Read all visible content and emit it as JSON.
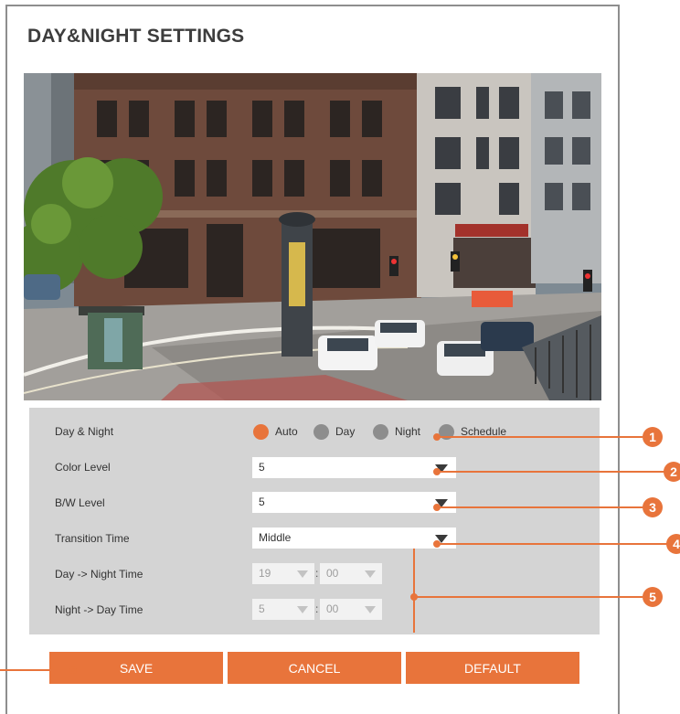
{
  "page": {
    "title": "DAY&NIGHT SETTINGS"
  },
  "day_night": {
    "label": "Day & Night",
    "options": [
      "Auto",
      "Day",
      "Night",
      "Schedule"
    ],
    "selected": "Auto"
  },
  "color_level": {
    "label": "Color Level",
    "value": "5"
  },
  "bw_level": {
    "label": "B/W Level",
    "value": "5"
  },
  "transition_time": {
    "label": "Transition Time",
    "value": "Middle"
  },
  "day_to_night": {
    "label": "Day -> Night Time",
    "hour": "19",
    "minute": "00",
    "separator": ":"
  },
  "night_to_day": {
    "label": "Night -> Day Time",
    "hour": "5",
    "minute": "00",
    "separator": ":"
  },
  "buttons": {
    "save": "SAVE",
    "cancel": "CANCEL",
    "default": "DEFAULT"
  },
  "callouts": [
    "1",
    "2",
    "3",
    "4",
    "5"
  ],
  "colors": {
    "accent": "#e8743b",
    "panel": "#d4d4d4",
    "frame": "#8e8e8e"
  }
}
